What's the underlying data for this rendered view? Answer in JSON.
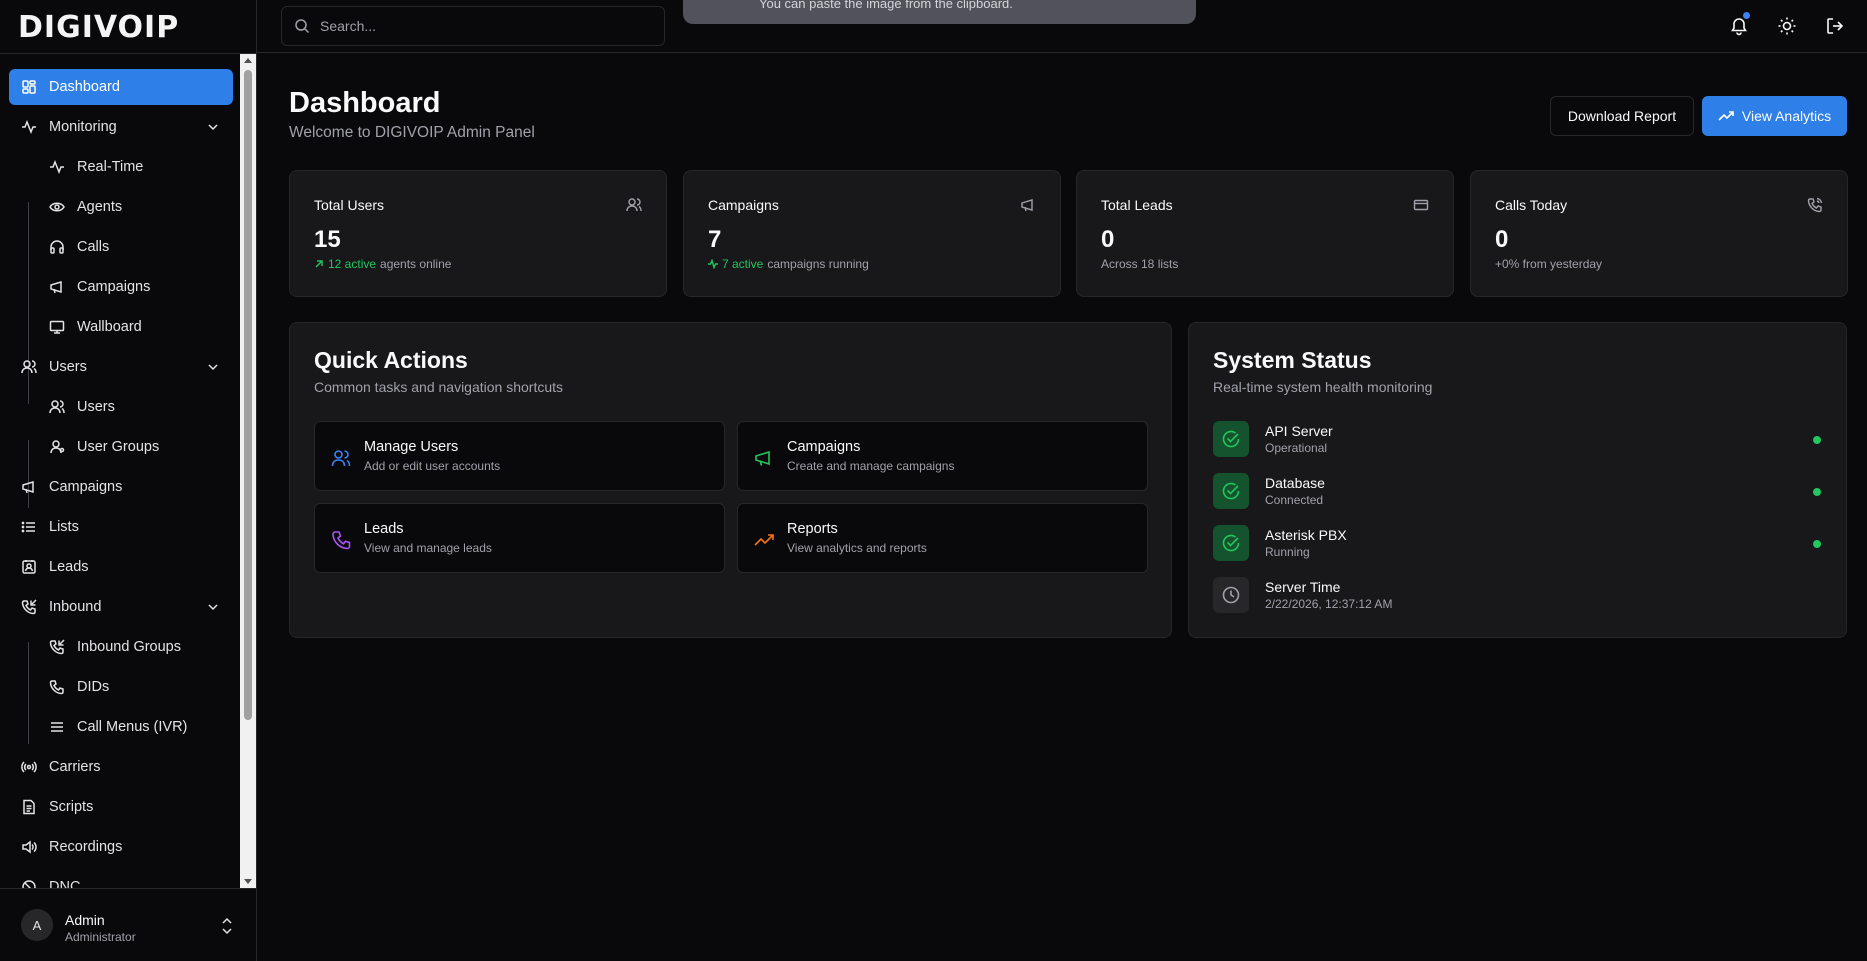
{
  "brand": {
    "logo": "DIGIVOIP"
  },
  "sidebar": {
    "items": [
      {
        "label": "Dashboard",
        "icon": "dashboard-icon"
      },
      {
        "label": "Monitoring",
        "icon": "activity-icon"
      },
      {
        "label": "Real-Time",
        "icon": "activity-icon"
      },
      {
        "label": "Agents",
        "icon": "eye-icon"
      },
      {
        "label": "Calls",
        "icon": "headphones-icon"
      },
      {
        "label": "Campaigns",
        "icon": "megaphone-icon"
      },
      {
        "label": "Wallboard",
        "icon": "monitor-icon"
      },
      {
        "label": "Users",
        "icon": "users-icon"
      },
      {
        "label": "Users",
        "icon": "users-icon"
      },
      {
        "label": "User Groups",
        "icon": "user-group-icon"
      },
      {
        "label": "Campaigns",
        "icon": "megaphone-icon"
      },
      {
        "label": "Lists",
        "icon": "list-icon"
      },
      {
        "label": "Leads",
        "icon": "contact-icon"
      },
      {
        "label": "Inbound",
        "icon": "phone-incoming-icon"
      },
      {
        "label": "Inbound Groups",
        "icon": "phone-incoming-icon"
      },
      {
        "label": "DIDs",
        "icon": "phone-icon"
      },
      {
        "label": "Call Menus (IVR)",
        "icon": "menu-icon"
      },
      {
        "label": "Carriers",
        "icon": "radio-icon"
      },
      {
        "label": "Scripts",
        "icon": "file-text-icon"
      },
      {
        "label": "Recordings",
        "icon": "volume-icon"
      },
      {
        "label": "DNC",
        "icon": "ban-icon"
      }
    ],
    "user": {
      "initial": "A",
      "name": "Admin",
      "role": "Administrator"
    }
  },
  "topbar": {
    "search_placeholder": "Search...",
    "toast_text": "You can paste the image from the clipboard."
  },
  "header": {
    "title": "Dashboard",
    "subtitle": "Welcome to DIGIVOIP Admin Panel",
    "download_label": "Download Report",
    "analytics_label": "View Analytics"
  },
  "stats": [
    {
      "label": "Total Users",
      "value": "15",
      "highlight": "12 active",
      "note": "agents online",
      "icon": "users-icon"
    },
    {
      "label": "Campaigns",
      "value": "7",
      "highlight": "7 active",
      "note": "campaigns running",
      "icon": "megaphone-icon"
    },
    {
      "label": "Total Leads",
      "value": "0",
      "highlight": "",
      "note": "Across 18 lists",
      "icon": "credit-card-icon"
    },
    {
      "label": "Calls Today",
      "value": "0",
      "highlight": "",
      "note": "+0% from yesterday",
      "icon": "phone-call-icon"
    }
  ],
  "quick_actions": {
    "title": "Quick Actions",
    "subtitle": "Common tasks and navigation shortcuts",
    "items": [
      {
        "title": "Manage Users",
        "desc": "Add or edit user accounts",
        "icon": "users-icon",
        "color": "#3b82f6"
      },
      {
        "title": "Campaigns",
        "desc": "Create and manage campaigns",
        "icon": "megaphone-icon",
        "color": "#22c55e"
      },
      {
        "title": "Leads",
        "desc": "View and manage leads",
        "icon": "phone-icon",
        "color": "#a855f7"
      },
      {
        "title": "Reports",
        "desc": "View analytics and reports",
        "icon": "trending-up-icon",
        "color": "#f97316"
      }
    ]
  },
  "system_status": {
    "title": "System Status",
    "subtitle": "Real-time system health monitoring",
    "items": [
      {
        "name": "API Server",
        "state": "Operational"
      },
      {
        "name": "Database",
        "state": "Connected"
      },
      {
        "name": "Asterisk PBX",
        "state": "Running"
      },
      {
        "name": "Server Time",
        "state": "2/22/2026, 12:37:12 AM"
      }
    ]
  },
  "colors": {
    "accent": "#2f7fe8",
    "success": "#22c55e",
    "background": "#09090b",
    "card": "#18181b"
  }
}
